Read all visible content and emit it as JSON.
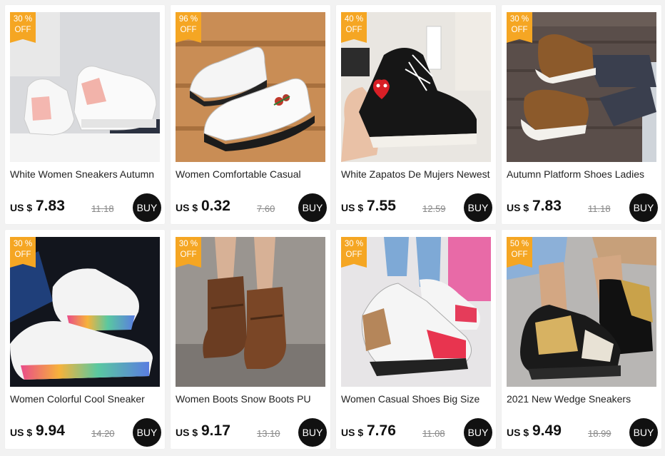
{
  "currency_label": "US $",
  "buy_label": "BUY",
  "off_label": "OFF",
  "products": [
    {
      "title": "White Women Sneakers Autumn",
      "discount": "30 %",
      "price": "7.83",
      "original": "11.18",
      "image": "white-pink-sneakers"
    },
    {
      "title": "Women Comfortable Casual",
      "discount": "96 %",
      "price": "0.32",
      "original": "7.60",
      "image": "white-floral-slip-on-shoes"
    },
    {
      "title": "White Zapatos De Mujers Newest",
      "discount": "40 %",
      "price": "7.55",
      "original": "12.59",
      "image": "black-heart-high-top"
    },
    {
      "title": "Autumn Platform Shoes Ladies",
      "discount": "30 %",
      "price": "7.83",
      "original": "11.18",
      "image": "brown-platform-shoes"
    },
    {
      "title": "Women Colorful Cool Sneaker",
      "discount": "30 %",
      "price": "9.94",
      "original": "14.20",
      "image": "rainbow-sneakers"
    },
    {
      "title": "Women Boots Snow Boots PU",
      "discount": "30 %",
      "price": "9.17",
      "original": "13.10",
      "image": "brown-ankle-boots"
    },
    {
      "title": "Women Casual Shoes Big Size",
      "discount": "30 %",
      "price": "7.76",
      "original": "11.08",
      "image": "red-leopard-sneakers"
    },
    {
      "title": "2021 New Wedge Sneakers",
      "discount": "50 %",
      "price": "9.49",
      "original": "18.99",
      "image": "gold-wedge-sneakers"
    }
  ]
}
